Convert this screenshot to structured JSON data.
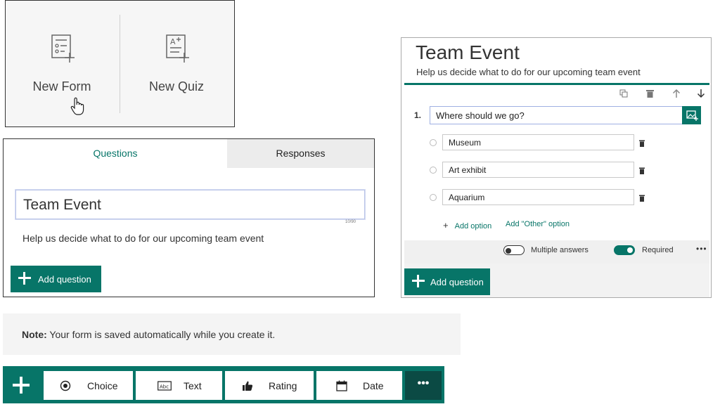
{
  "new_tiles": {
    "new_form_label": "New Form",
    "new_quiz_label": "New Quiz"
  },
  "editor": {
    "tabs": {
      "questions": "Questions",
      "responses": "Responses"
    },
    "title_value": "Team Event",
    "title_counter": "10/90",
    "description": "Help us decide what to do for our upcoming team event",
    "add_question": "Add question"
  },
  "question_panel": {
    "form_title": "Team Event",
    "form_description": "Help us decide what to do for our upcoming team event",
    "question_number": "1.",
    "question_text": "Where should we go?",
    "options": [
      "Museum",
      "Art exhibit",
      "Aquarium"
    ],
    "add_option": "Add option",
    "add_other_option": "Add \"Other\" option",
    "multiple_answers_label": "Multiple answers",
    "multiple_answers_on": false,
    "required_label": "Required",
    "required_on": true,
    "more": "•••",
    "add_question": "Add question"
  },
  "note": {
    "bold": "Note:",
    "text": " Your form is saved automatically while you create it."
  },
  "toolbar": {
    "choice": "Choice",
    "text": "Text",
    "rating": "Rating",
    "date": "Date",
    "more": "•••"
  },
  "colors": {
    "accent": "#077568",
    "accent_dark": "#0b4a44"
  }
}
